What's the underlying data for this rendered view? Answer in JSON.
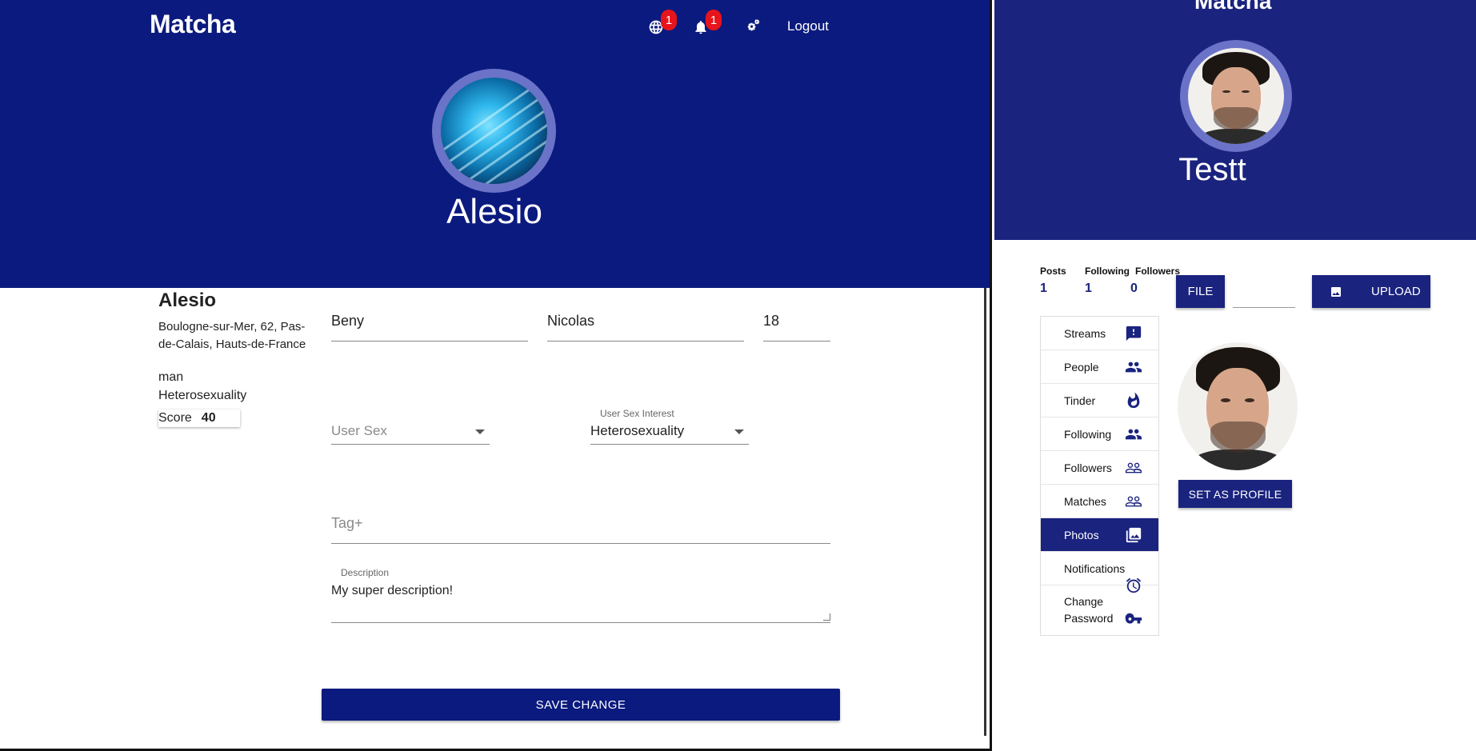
{
  "left": {
    "brand": "Matcha",
    "nav": {
      "globe_badge": "1",
      "bell_badge": "1",
      "logout": "Logout"
    },
    "hero_name": "Alesio",
    "profile": {
      "name": "Alesio",
      "location": "Boulogne-sur-Mer, 62, Pas-de-Calais, Hauts-de-France",
      "sex": "man",
      "orientation": "Heterosexuality",
      "score_label": "Score",
      "score_value": "40"
    },
    "form": {
      "first_name": "Beny",
      "last_name": "Nicolas",
      "age": "18",
      "user_sex_placeholder": "User Sex",
      "sex_interest_label": "User Sex Interest",
      "sex_interest_value": "Heterosexuality",
      "tag_placeholder": "Tag+",
      "description_label": "Description",
      "description_value": "My super description!",
      "save_button": "SAVE CHANGE"
    }
  },
  "right": {
    "brand": "Matcha",
    "hero_name": "Testt",
    "stats": {
      "posts_label": "Posts",
      "posts_value": "1",
      "following_label": "Following",
      "following_value": "1",
      "followers_label": "Followers",
      "followers_value": "0"
    },
    "buttons": {
      "file": "FILE",
      "upload": "UPLOAD",
      "set_profile": "SET AS PROFILE"
    },
    "menu": [
      {
        "label": "Streams",
        "icon": "feedback-icon"
      },
      {
        "label": "People",
        "icon": "people-icon"
      },
      {
        "label": "Tinder",
        "icon": "flame-icon"
      },
      {
        "label": "Following",
        "icon": "people-icon"
      },
      {
        "label": "Followers",
        "icon": "people-outline-icon"
      },
      {
        "label": "Matches",
        "icon": "people-outline-icon"
      },
      {
        "label": "Photos",
        "icon": "photo-library-icon",
        "active": true
      },
      {
        "label": "Notifications",
        "icon": "alarm-icon"
      },
      {
        "label": "Change Password",
        "icon": "key-icon"
      }
    ]
  },
  "colors": {
    "header_dark": "#0b1a7e",
    "header_right": "#1a237e",
    "avatar_ring": "#6a73c8",
    "badge": "#e8141c"
  }
}
